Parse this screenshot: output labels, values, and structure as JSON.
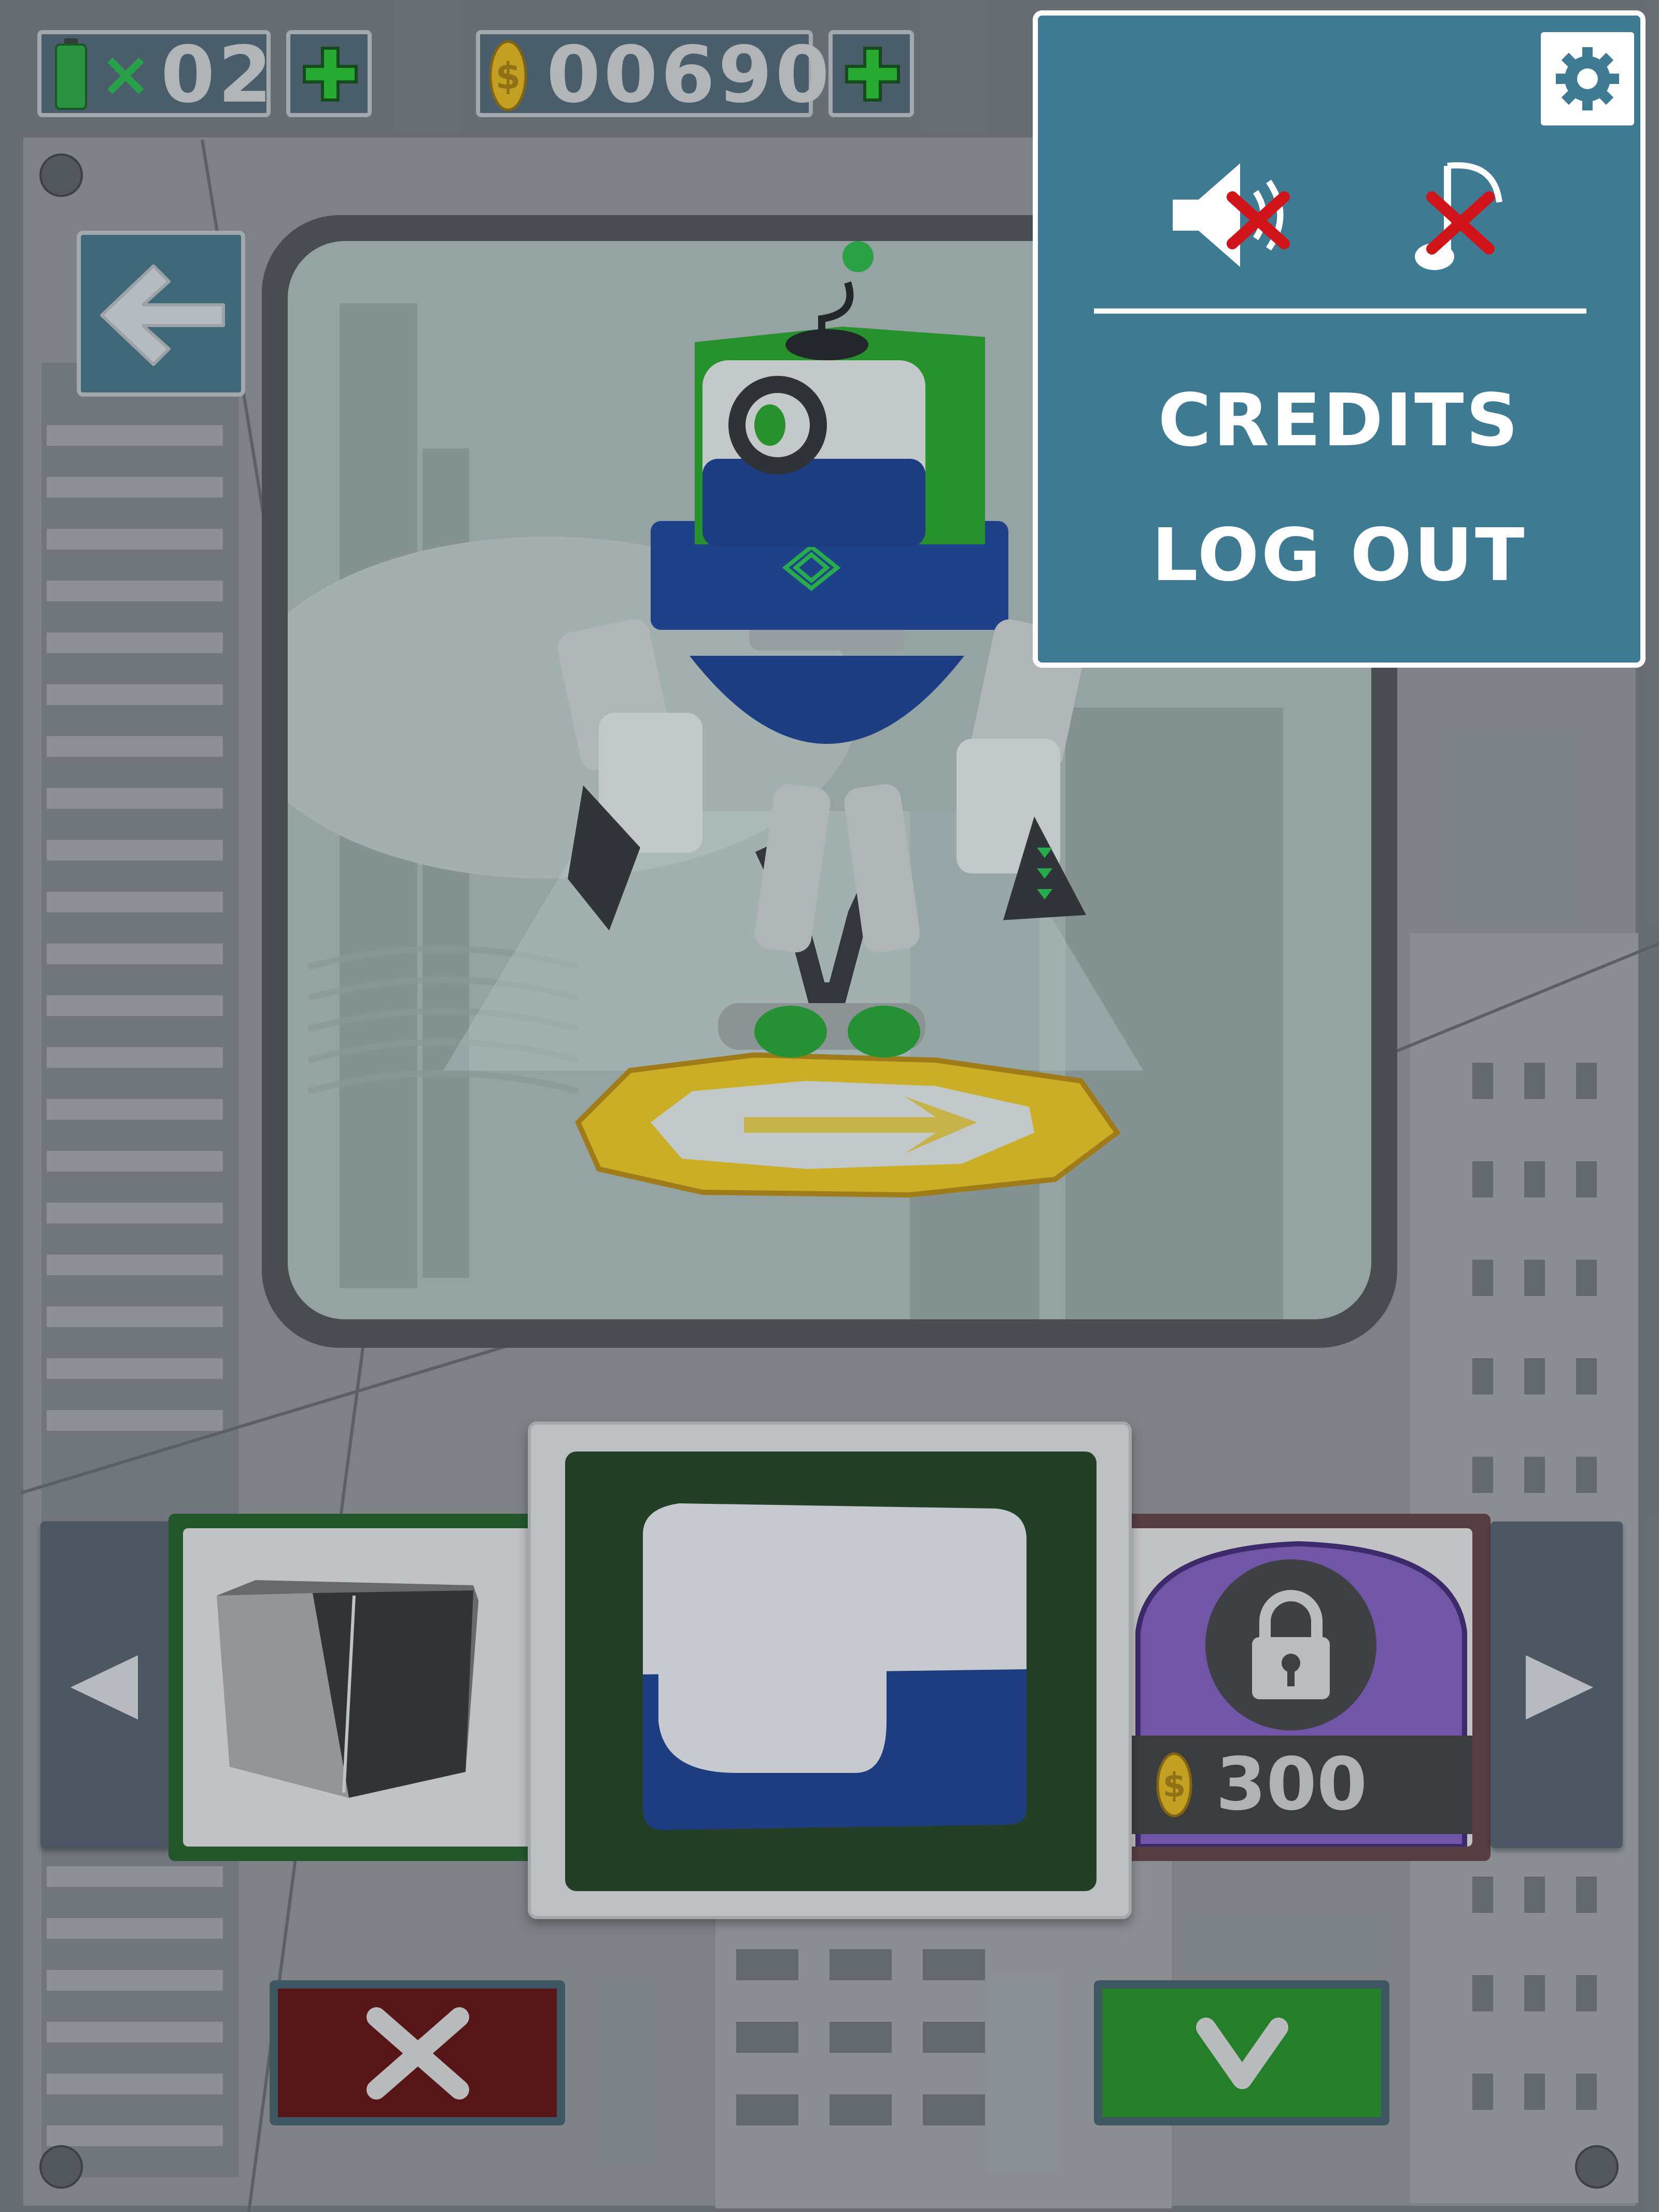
{
  "hud": {
    "battery_count": "02",
    "battery_multiplier": "×",
    "coins": "00690"
  },
  "settings_menu": {
    "credits_label": "CREDITS",
    "logout_label": "LOG OUT",
    "sound_muted": true,
    "music_muted": true
  },
  "part_selector": {
    "locked_price": "300"
  },
  "colors": {
    "panel_blue": "#3f7a93",
    "confirm_green": "#1e8a20",
    "cancel_red": "#5a0a0a",
    "robot_blue": "#143a8c",
    "robot_green": "#1fa024"
  },
  "icons": {
    "back": "arrow-left-icon",
    "settings": "gear-icon",
    "sound": "speaker-muted-icon",
    "music": "music-note-muted-icon",
    "lock": "lock-icon",
    "coin": "coin-icon",
    "battery": "battery-icon",
    "cancel": "x-icon",
    "confirm": "checkmark-icon"
  }
}
